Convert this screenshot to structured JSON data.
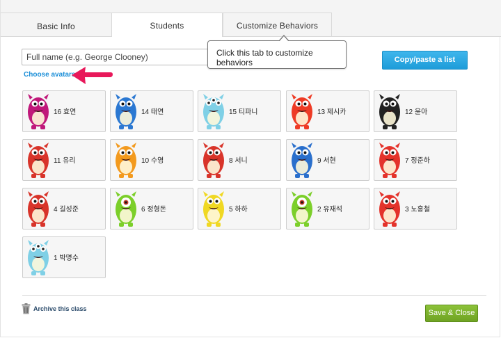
{
  "tabs": [
    {
      "label": "Basic Info",
      "active": false
    },
    {
      "label": "Students",
      "active": true
    },
    {
      "label": "Customize Behaviors",
      "active": false
    }
  ],
  "name_input": {
    "placeholder": "Full name (e.g. George Clooney)",
    "value": ""
  },
  "tooltip": {
    "text": "Click this tab to customize behaviors"
  },
  "choose_avatars_label": "Choose avatars",
  "copy_paste_label": "Copy/paste a list",
  "students": [
    {
      "name": "16 효연",
      "avatar": "magenta-monster-icon",
      "color": "#c0187a"
    },
    {
      "name": "14 태연",
      "avatar": "blue-monster-icon",
      "color": "#2b78d2"
    },
    {
      "name": "15 티파니",
      "avatar": "cyan-monster-icon",
      "color": "#7fd0e6"
    },
    {
      "name": "13 제시카",
      "avatar": "red-monster-icon",
      "color": "#ee3b25"
    },
    {
      "name": "12 윤아",
      "avatar": "black-white-monster-icon",
      "color": "#222222"
    },
    {
      "name": "11 유리",
      "avatar": "red-spiky-monster-icon",
      "color": "#d8342a"
    },
    {
      "name": "10 수영",
      "avatar": "orange-monster-icon",
      "color": "#f39a1e"
    },
    {
      "name": "8 서니",
      "avatar": "red-spiky-monster-icon",
      "color": "#d8342a"
    },
    {
      "name": "9 서현",
      "avatar": "blue-bird-monster-icon",
      "color": "#2a6fcc"
    },
    {
      "name": "7 정준하",
      "avatar": "red-furry-monster-icon",
      "color": "#e4332b"
    },
    {
      "name": "4 길성준",
      "avatar": "red-spiky-monster-icon",
      "color": "#d8342a"
    },
    {
      "name": "6 정형돈",
      "avatar": "green-monster-icon",
      "color": "#7ccf2a"
    },
    {
      "name": "5 하하",
      "avatar": "yellow-black-monster-icon",
      "color": "#f0d823"
    },
    {
      "name": "2 유재석",
      "avatar": "green-monster-icon",
      "color": "#7ccf2a"
    },
    {
      "name": "3 노홍철",
      "avatar": "red-furry-monster-icon",
      "color": "#e4332b"
    },
    {
      "name": "1 박명수",
      "avatar": "cyan-monster-icon",
      "color": "#7fd0e6"
    }
  ],
  "archive_label": "Archive this class",
  "save_label": "Save & Close",
  "colors": {
    "accent_blue": "#1e9cd9",
    "save_green": "#6fa323",
    "arrow_pink": "#e8185a"
  }
}
